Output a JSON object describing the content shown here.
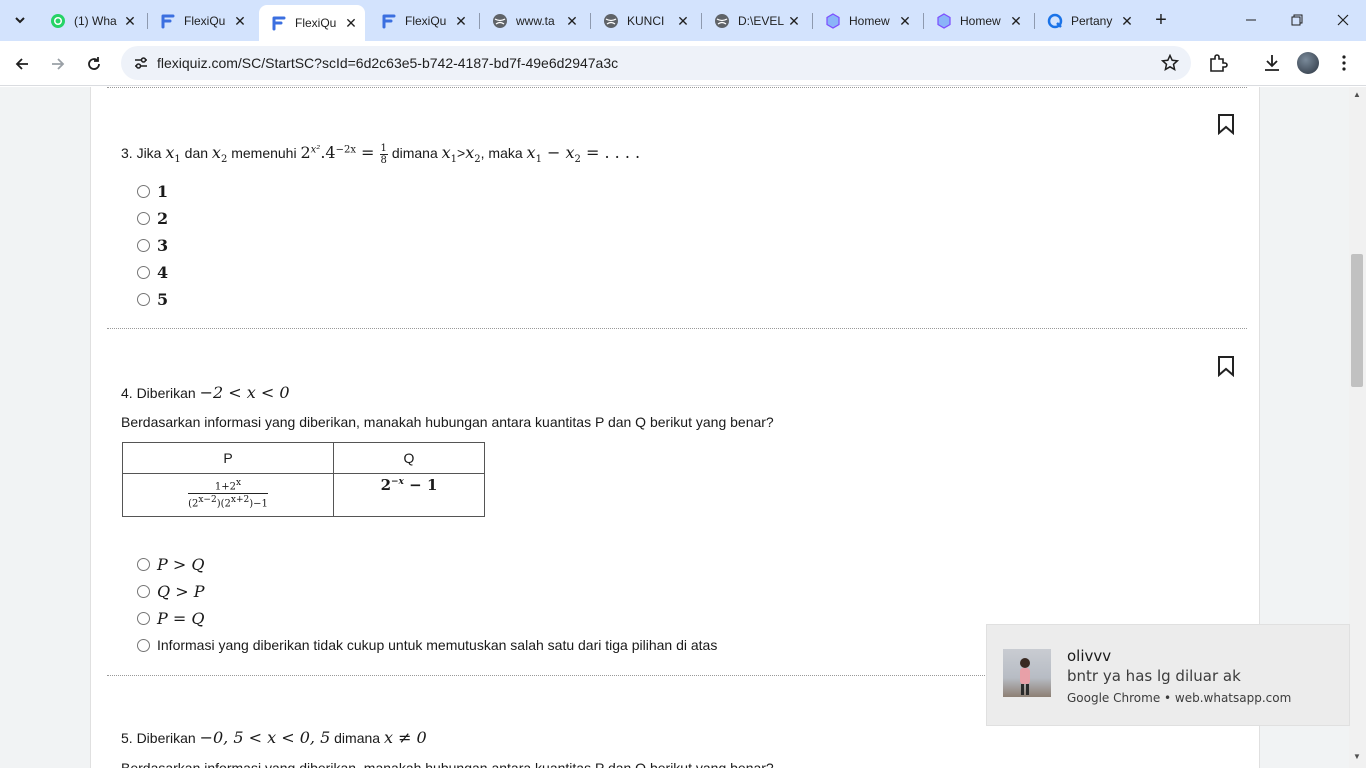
{
  "tabs": [
    {
      "title": "(1) Wha",
      "icon": "whatsapp-icon",
      "active": false
    },
    {
      "title": "FlexiQu",
      "icon": "flexiquiz-icon",
      "active": false
    },
    {
      "title": "FlexiQu",
      "icon": "flexiquiz-icon",
      "active": true
    },
    {
      "title": "FlexiQu",
      "icon": "flexiquiz-icon",
      "active": false
    },
    {
      "title": "www.ta",
      "icon": "globe-icon",
      "active": false
    },
    {
      "title": "KUNCI",
      "icon": "globe-icon",
      "active": false
    },
    {
      "title": "D:\\EVEL",
      "icon": "globe-icon",
      "active": false
    },
    {
      "title": "Homew",
      "icon": "cube-icon",
      "active": false
    },
    {
      "title": "Homew",
      "icon": "cube-icon",
      "active": false
    },
    {
      "title": "Pertany",
      "icon": "q-icon",
      "active": false
    }
  ],
  "address_bar": {
    "url": "flexiquiz.com/SC/StartSC?scId=6d2c63e5-b742-4187-bd7f-49e6d2947a3c"
  },
  "question3": {
    "number": "3. Jika",
    "w_dan": "dan",
    "w_memenuhi": "memenuhi",
    "w_dimana": "dimana",
    "w_maka": ", maka",
    "x1": "x",
    "sub1": "1",
    "x2": "x",
    "sub2": "2",
    "eq_base1": "2",
    "eq_exp1": "x²",
    "eq_mid": ".4",
    "eq_exp2": "−2x",
    "eq_equals": " = ",
    "frac_num": "1",
    "frac_den": "8",
    "gt": ">",
    "minus": " − ",
    "tail": " = . . . .",
    "options": [
      "1",
      "2",
      "3",
      "4",
      "5"
    ]
  },
  "question4": {
    "intro": "4. Diberikan",
    "condition": "−2 < x < 0",
    "prompt": "Berdasarkan informasi yang diberikan, manakah hubungan antara kuantitas P dan Q berikut yang benar?",
    "table": {
      "headers": [
        "P",
        "Q"
      ],
      "p_num": "1+2",
      "p_num_exp": "x",
      "p_den_a": "(2",
      "p_den_a_exp": "x−2",
      "p_den_b": ")(2",
      "p_den_b_exp": "x+2",
      "p_den_c": ")−1",
      "q_base": "2",
      "q_exp": "−x",
      "q_tail": " − 1"
    },
    "options": [
      "P > Q",
      "Q > P",
      "P = Q",
      "Informasi yang diberikan tidak cukup untuk memutuskan salah satu dari tiga pilihan di atas"
    ]
  },
  "question5": {
    "intro": "5. Diberikan",
    "condition": "−0, 5 < x < 0, 5",
    "w_dimana": "dimana",
    "condition2": "x ≠ 0",
    "prompt_partial": "Berdasarkan informasi yang diberikan, manakah hubungan antara kuantitas P dan Q berikut yang benar?"
  },
  "notification": {
    "name": "olivvv",
    "message": "bntr ya has lg diluar ak",
    "source": "Google Chrome • web.whatsapp.com"
  }
}
